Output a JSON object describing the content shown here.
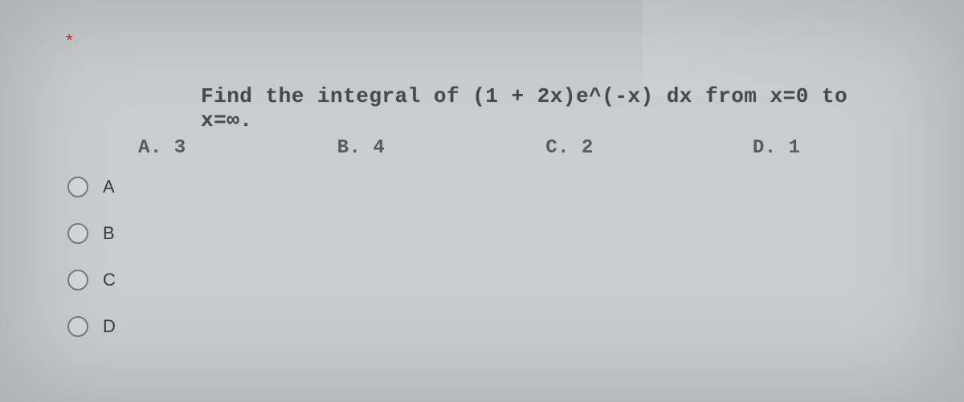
{
  "required_marker": "*",
  "question": {
    "text": "Find the integral of (1 + 2x)e^(-x) dx from x=0 to x=∞.",
    "choices": {
      "a": "A. 3",
      "b": "B. 4",
      "c": "C. 2",
      "d": "D. 1"
    }
  },
  "options": [
    {
      "label": "A"
    },
    {
      "label": "B"
    },
    {
      "label": "C"
    },
    {
      "label": "D"
    }
  ]
}
